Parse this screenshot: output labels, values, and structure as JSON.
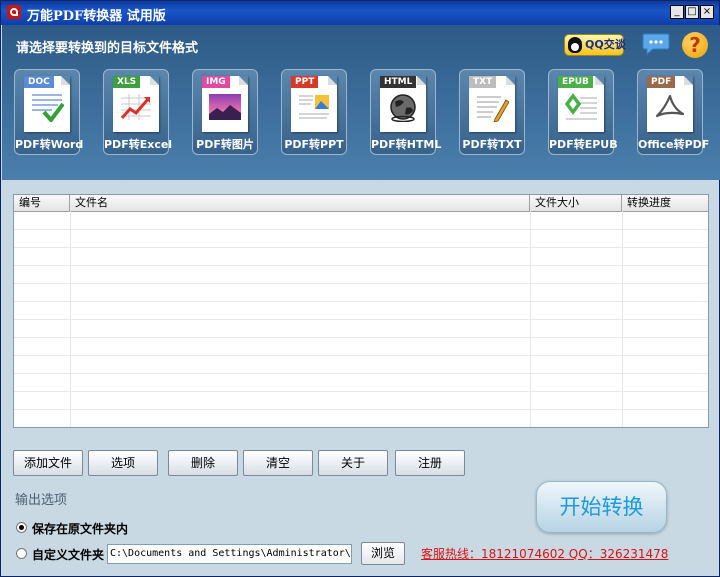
{
  "window": {
    "title": "万能PDF转换器  试用版",
    "min_label": "_",
    "max_label": "□",
    "close_label": "×"
  },
  "header": {
    "prompt": "请选择要转换到的目标文件格式",
    "qq_button": "QQ交谈",
    "help_label": "?"
  },
  "formats": [
    {
      "tag": "DOC",
      "label": "PDF转Word",
      "tag_color": "#5a8ad8",
      "icon": "word-doc-icon"
    },
    {
      "tag": "XLS",
      "label": "PDF转Excel",
      "tag_color": "#3f9e3f",
      "icon": "excel-chart-icon"
    },
    {
      "tag": "IMG",
      "label": "PDF转图片",
      "tag_color": "#e04aa0",
      "icon": "image-icon"
    },
    {
      "tag": "PPT",
      "label": "PDF转PPT",
      "tag_color": "#d83a2a",
      "icon": "ppt-icon"
    },
    {
      "tag": "HTML",
      "label": "PDF转HTML",
      "tag_color": "#333333",
      "icon": "globe-icon"
    },
    {
      "tag": "TXT",
      "label": "PDF转TXT",
      "tag_color": "#bdbdbd",
      "icon": "text-pen-icon"
    },
    {
      "tag": "EPUB",
      "label": "PDF转EPUB",
      "tag_color": "#49b048",
      "icon": "epub-icon"
    },
    {
      "tag": "PDF",
      "label": "Office转PDF",
      "tag_color": "#9a6a4a",
      "icon": "pdf-icon"
    }
  ],
  "table": {
    "columns": [
      "编号",
      "文件名",
      "文件大小",
      "转换进度"
    ],
    "rows": []
  },
  "actions": [
    "添加文件",
    "选项",
    "删除",
    "清空",
    "关于",
    "注册"
  ],
  "output": {
    "section_label": "输出选项",
    "option_source": "保存在原文件夹内",
    "option_custom": "自定义文件夹",
    "selected": "source",
    "path": "C:\\Documents and Settings\\Administrator\\桌面",
    "browse_label": "浏览"
  },
  "start_button": "开始转换",
  "hotline": "客服热线：18121074602 QQ：326231478",
  "colors": {
    "accent": "#1a9ae0",
    "hotline": "#e01010",
    "header_bg": "#36628c"
  }
}
